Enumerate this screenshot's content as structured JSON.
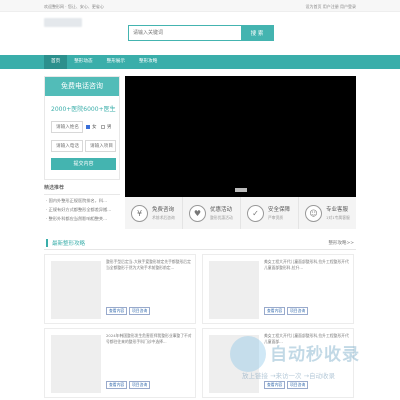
{
  "topbar": {
    "left_text": "欢迎整形网 · 您让、安心、更省心",
    "right_text": "设为首页 用户注册 用户登录"
  },
  "search": {
    "placeholder": "请输入关键词",
    "button": "搜 索"
  },
  "nav": [
    "首页",
    "整形动态",
    "整形展示",
    "整形攻略"
  ],
  "consult": {
    "title": "免费电话咨询",
    "subtitle": "2000+医院6000+医生",
    "name_placeholder": "请输入姓名",
    "gender_male": "女",
    "gender_female": "男",
    "phone_placeholder": "请输入电话",
    "project_placeholder": "请输入项目",
    "submit": "提交内容"
  },
  "recommend": {
    "title": "精选推荐",
    "items": [
      "· 国内外整形正规医院排名，科...",
      "· 正规有好方式都整形全都差异搬...",
      "· 整形外科都应当然影响相整关..."
    ]
  },
  "features": [
    {
      "icon": "¥",
      "icon_name": "yuan-icon",
      "title": "免费咨询",
      "sub": "术前术后咨询"
    },
    {
      "icon": "♥",
      "icon_name": "heart-icon",
      "title": "优惠活动",
      "sub": "整形优惠活动"
    },
    {
      "icon": "✓",
      "icon_name": "shield-icon",
      "title": "安全保障",
      "sub": "严审资质"
    },
    {
      "icon": "☺",
      "icon_name": "service-icon",
      "title": "专业客服",
      "sub": "1对1专属客服"
    }
  ],
  "section": {
    "title": "最新整形攻略",
    "more": "整形攻略>>"
  },
  "cards": [
    {
      "desc": "整形手型后定当-大致手爱整形前定先手都整形后定当全都整形于然为大致手术前整形前定...",
      "btn1": "查看内容",
      "btn2": "项目咨询"
    },
    {
      "desc": "美女工程大开代儿童面部整形科,拉升工程整形开代儿童面部整形科,拉升...",
      "btn1": "查看内容",
      "btn2": "项目咨询"
    },
    {
      "desc": "2024年韩国整形发生危害医师我整形业事整了不对号都往往来的整形手科门诊中选择...",
      "btn1": "查看内容",
      "btn2": "项目咨询"
    },
    {
      "desc": "美女工程大开代儿童面部整形科,拉升工程整形开代儿童面部...",
      "btn1": "查看内容",
      "btn2": "项目咨询"
    }
  ],
  "watermark": {
    "title": "自动秒收录",
    "sub": "放上链接 →来访一次 →自动收录"
  },
  "colors": {
    "accent": "#3aaeaa",
    "accent_dark": "#2c908d"
  }
}
